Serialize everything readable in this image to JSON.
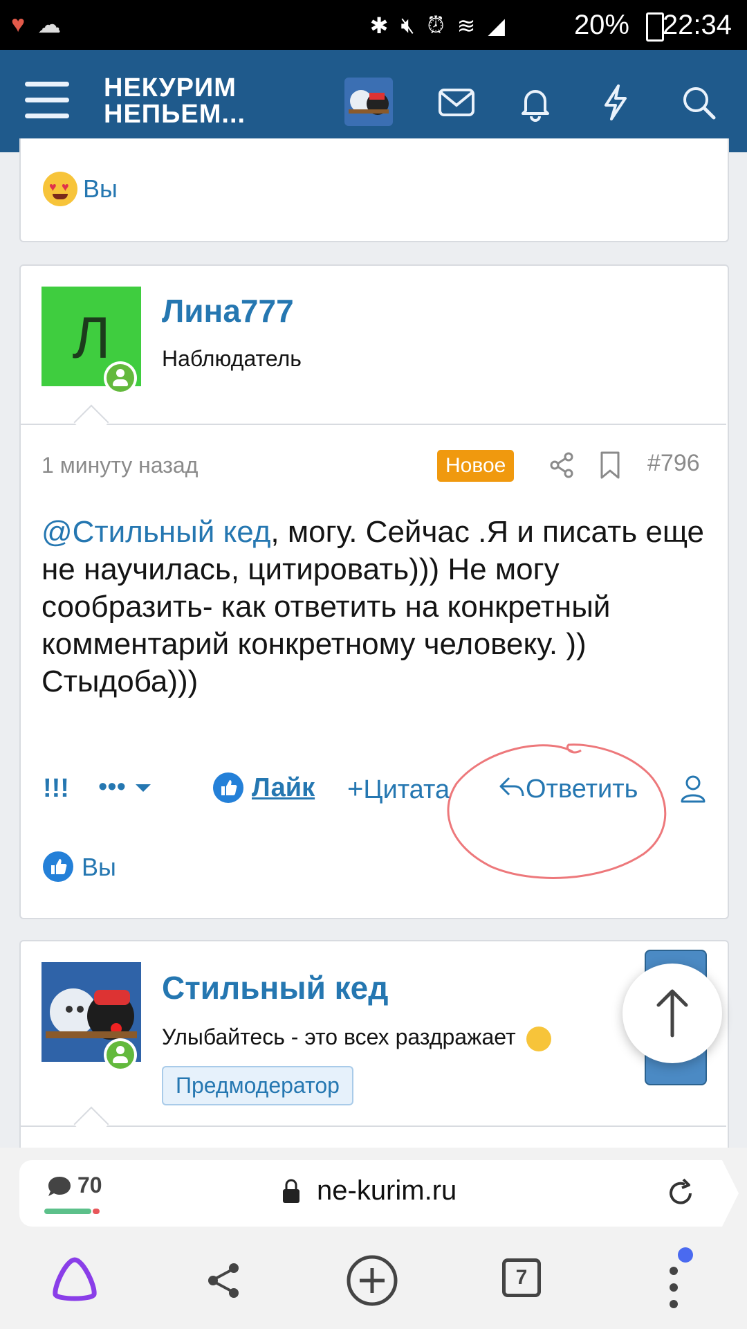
{
  "status_bar": {
    "time": "22:34",
    "battery": "20%"
  },
  "header": {
    "logo_line1": "НЕКУРИМ",
    "logo_line2": "НЕПЬЕМ..."
  },
  "prev_card": {
    "reaction_user": "Вы"
  },
  "post": {
    "author": "Лина777",
    "avatar_letter": "Л",
    "user_title": "Наблюдатель",
    "time": "1 минуту назад",
    "badge": "Новое",
    "number": "#796",
    "mention": "@Стильный кед",
    "text": ", могу. Сейчас .Я и писать еще не научилась, цитировать))) Не могу сообразить- как ответить на конкретный комментарий конкретному человеку. )) Стыдоба)))",
    "actions": {
      "report": "!!!",
      "more": "•••",
      "like": "Лайк",
      "quote": "Цитата",
      "reply": "Ответить"
    },
    "reaction_user": "Вы"
  },
  "next_post": {
    "author": "Стильный кед",
    "user_title": "Улыбайтесь - это всех раздражает",
    "role": "Предмодератор"
  },
  "browser": {
    "comment_count": "70",
    "url": "ne-kurim.ru",
    "tabs_count": "7"
  }
}
